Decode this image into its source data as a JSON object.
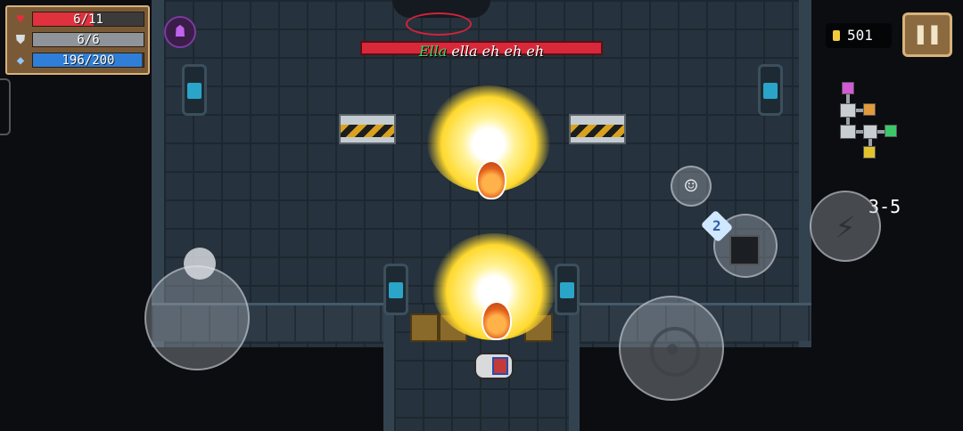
{
  "hud": {
    "health": {
      "text": "6/11",
      "fraction": 0.545,
      "color": "#e0313e",
      "icon": "heart-icon"
    },
    "armor": {
      "text": "6/6",
      "fraction": 1.0,
      "color": "#8e9499",
      "icon": "shield-icon"
    },
    "energy": {
      "text": "196/200",
      "fraction": 0.98,
      "color": "#2f7fd8",
      "icon": "energy-crystal-icon"
    },
    "status_effect_icon": "cursed-helmet-icon"
  },
  "boss": {
    "name_highlight": "Ella",
    "name_rest": " ella eh eh eh",
    "health_fraction": 1.0,
    "bar_color": "#d8283a"
  },
  "currency": {
    "coins": "501",
    "icon": "coin-icon"
  },
  "buttons": {
    "pause_icon": "pause-icon",
    "emote_icon": "smiley-icon",
    "skill_icon": "lightning-icon",
    "attack_icon": "crosshair-icon",
    "weapon_swap_icon": "weapon-swap-icon"
  },
  "weapon": {
    "energy_cost": "2"
  },
  "level": "3-5"
}
